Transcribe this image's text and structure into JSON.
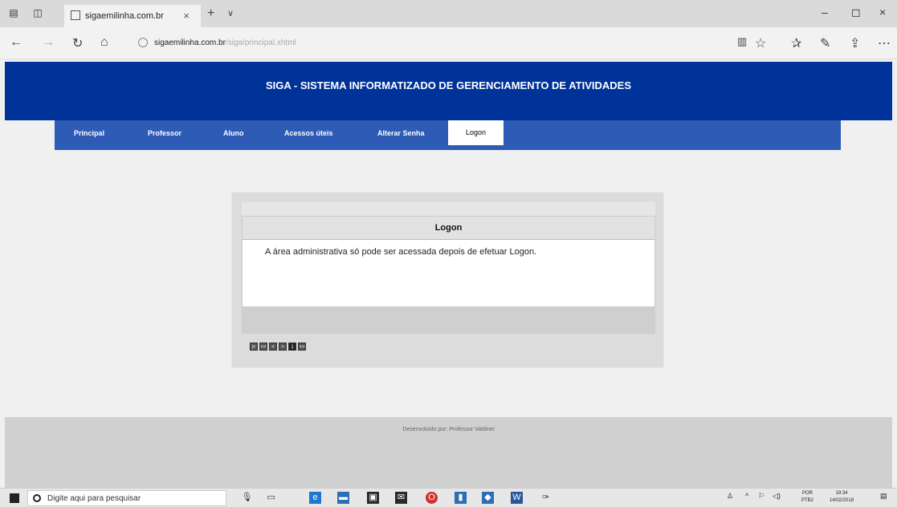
{
  "browser": {
    "tab_title": "sigaemilinha.com.br",
    "tab_close": "×",
    "new_tab": "+",
    "tab_list": "∨",
    "url_domain": "sigaemilinha.com.br",
    "url_path": "/siga/principal.xhtml",
    "win_minimize": "–",
    "win_restore": "◻",
    "win_close": "×"
  },
  "site": {
    "title": "SIGA - SISTEMA INFORMATIZADO DE GERENCIAMENTO DE ATIVIDADES",
    "menu": [
      "Principal",
      "Professor",
      "Aluno",
      "Acessos úteis",
      "Alterar Senha",
      "Logon"
    ],
    "active_menu": "Logon",
    "panel_title": "Logon",
    "panel_message": "A área administrativa só pode ser acessada depois de efetuar Logon.",
    "pager": [
      "|<",
      "<<",
      "<",
      ">",
      "1",
      ">>"
    ],
    "footer_credit": "Desenvolvido por: Professor Valdinei"
  },
  "taskbar": {
    "search_placeholder": "Digite aqui para pesquisar",
    "lang_top": "POR",
    "lang_bottom": "PTB2",
    "time": "19:34",
    "date": "14/02/2018"
  },
  "colors": {
    "header": "#003399",
    "menu": "#2d5bb5"
  }
}
